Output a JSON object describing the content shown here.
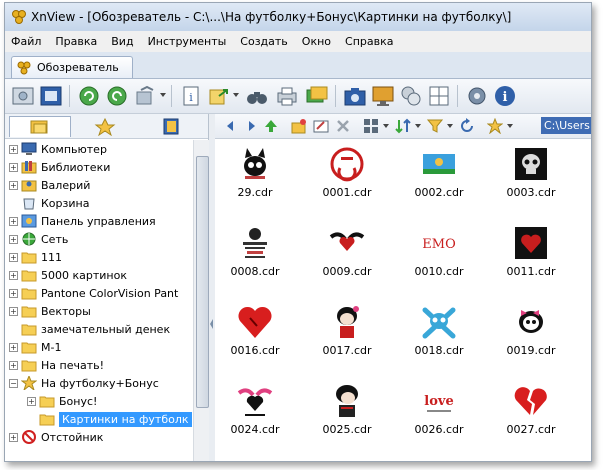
{
  "window": {
    "title": "XnView - [Обозреватель - C:\\...\\На футболку+Бонус\\Картинки на футболку\\]"
  },
  "menu": [
    "Файл",
    "Правка",
    "Вид",
    "Инструменты",
    "Создать",
    "Окно",
    "Справка"
  ],
  "tabs": [
    {
      "label": "Обозреватель"
    }
  ],
  "path": {
    "value": "C:\\Users"
  },
  "tree": [
    {
      "label": "Компьютер",
      "icon": "computer-icon",
      "indent": 0,
      "expander": "+"
    },
    {
      "label": "Библиотеки",
      "icon": "libraries-icon",
      "indent": 0,
      "expander": "+"
    },
    {
      "label": "Валерий",
      "icon": "user-folder-icon",
      "indent": 0,
      "expander": "+"
    },
    {
      "label": "Корзина",
      "icon": "recycle-bin-icon",
      "indent": 0,
      "expander": ""
    },
    {
      "label": "Панель управления",
      "icon": "control-panel-icon",
      "indent": 0,
      "expander": "+"
    },
    {
      "label": "Сеть",
      "icon": "network-icon",
      "indent": 0,
      "expander": "+"
    },
    {
      "label": "111",
      "icon": "folder-icon",
      "indent": 0,
      "expander": "+"
    },
    {
      "label": "5000 картинок",
      "icon": "folder-icon",
      "indent": 0,
      "expander": "+"
    },
    {
      "label": "Pantone ColorVision Pant",
      "icon": "folder-icon",
      "indent": 0,
      "expander": "+"
    },
    {
      "label": "Векторы",
      "icon": "folder-icon",
      "indent": 0,
      "expander": "+"
    },
    {
      "label": "замечательный денек",
      "icon": "folder-icon",
      "indent": 0,
      "expander": ""
    },
    {
      "label": "М-1",
      "icon": "folder-icon",
      "indent": 0,
      "expander": "+"
    },
    {
      "label": "На печать!",
      "icon": "folder-icon",
      "indent": 0,
      "expander": "+"
    },
    {
      "label": "На футболку+Бонус",
      "icon": "star-folder-icon",
      "indent": 0,
      "expander": "−"
    },
    {
      "label": "Бонус!",
      "icon": "folder-icon",
      "indent": 1,
      "expander": "+"
    },
    {
      "label": "Картинки на футболк",
      "icon": "folder-icon",
      "indent": 1,
      "expander": "",
      "selected": true
    },
    {
      "label": "Отстойник",
      "icon": "blocked-icon",
      "indent": 0,
      "expander": "+"
    }
  ],
  "thumbnails": [
    {
      "name": "29.cdr",
      "art": "cat-skull-icon"
    },
    {
      "name": "0001.cdr",
      "art": "ussr-emblem-icon"
    },
    {
      "name": "0002.cdr",
      "art": "flag-icon"
    },
    {
      "name": "0003.cdr",
      "art": "skull-dark-icon"
    },
    {
      "name": "0008.cdr",
      "art": "text-art-icon"
    },
    {
      "name": "0009.cdr",
      "art": "winged-heart-icon"
    },
    {
      "name": "0010.cdr",
      "art": "emo-text-icon",
      "text": "EMO"
    },
    {
      "name": "0011.cdr",
      "art": "dark-heart-icon"
    },
    {
      "name": "0016.cdr",
      "art": "red-heart-icon"
    },
    {
      "name": "0017.cdr",
      "art": "emo-girl-icon"
    },
    {
      "name": "0018.cdr",
      "art": "crossbones-icon"
    },
    {
      "name": "0019.cdr",
      "art": "skull-bow-icon"
    },
    {
      "name": "0024.cdr",
      "art": "heart-wings-icon"
    },
    {
      "name": "0025.cdr",
      "art": "emo-boy-icon"
    },
    {
      "name": "0026.cdr",
      "art": "love-text-icon",
      "text": "love"
    },
    {
      "name": "0027.cdr",
      "art": "broken-heart-icon"
    }
  ]
}
